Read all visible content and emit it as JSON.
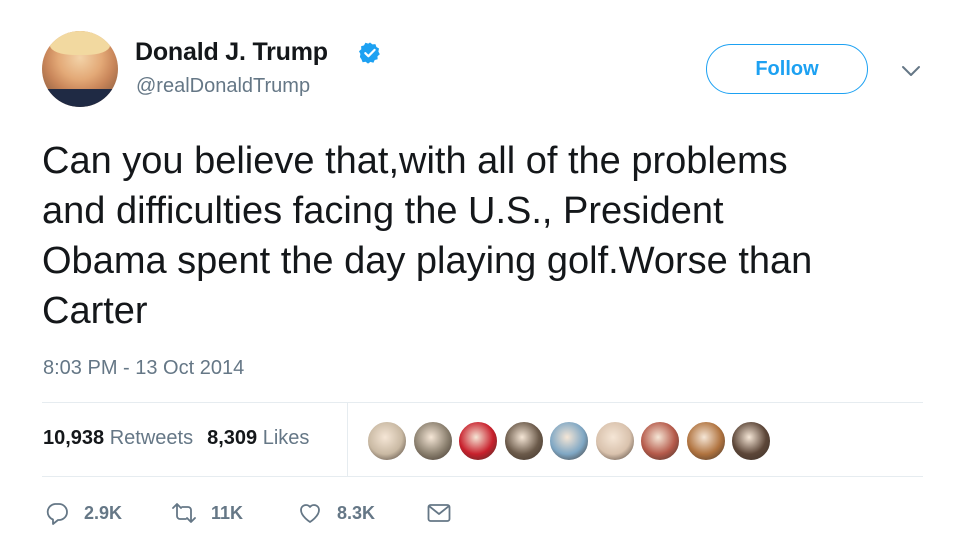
{
  "user": {
    "name": "Donald J. Trump",
    "handle": "@realDonaldTrump",
    "verified": true
  },
  "follow_label": "Follow",
  "tweet": {
    "text": "Can you believe that,with all of the problems\nand difficulties facing the U.S., President\nObama spent the day playing golf.Worse than\nCarter",
    "timestamp": "8:03 PM - 13 Oct 2014"
  },
  "stats": {
    "retweets_count": "10,938",
    "retweets_label": "Retweets",
    "likes_count": "8,309",
    "likes_label": "Likes"
  },
  "likers": [
    {
      "color": "#c9b9a3"
    },
    {
      "color": "#8a7f6e"
    },
    {
      "color": "#c8202c"
    },
    {
      "color": "#6b5a4a"
    },
    {
      "color": "#7fa7c4"
    },
    {
      "color": "#d9c2ad"
    },
    {
      "color": "#b55a4a"
    },
    {
      "color": "#b0733f"
    },
    {
      "color": "#5c4638"
    }
  ],
  "actions": {
    "replies": "2.9K",
    "retweets": "11K",
    "likes": "8.3K"
  },
  "colors": {
    "accent": "#1da1f2",
    "muted": "#657786",
    "text": "#14171a"
  },
  "icons": [
    "verified-badge-icon",
    "chevron-down-icon",
    "reply-icon",
    "retweet-icon",
    "heart-icon",
    "mail-icon"
  ]
}
